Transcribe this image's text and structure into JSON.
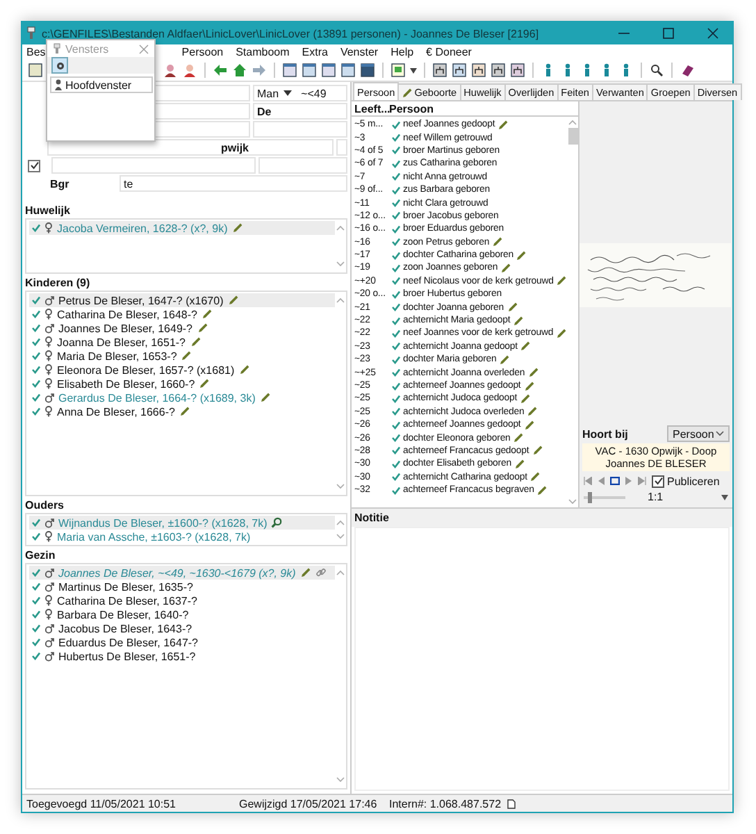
{
  "window": {
    "title": "c:\\GENFILES\\Bestanden Aldfaer\\LinicLover\\LinicLover (13891 personen) - Joannes De Bleser [2196]"
  },
  "menu": [
    "Bes",
    "Persoon",
    "Stamboom",
    "Extra",
    "Venster",
    "Help",
    "€ Doneer"
  ],
  "popup": {
    "title": "Vensters",
    "items": [
      {
        "label": "Hoofdvenster",
        "selected": true
      }
    ]
  },
  "form": {
    "sex": "Man",
    "age": "~<49",
    "surname": "De",
    "place": "pwijk",
    "flag": {
      "checked": true
    },
    "label": "Bgr",
    "value": "te"
  },
  "sections": [
    {
      "title": "Huwelijk",
      "rows": [
        {
          "text": "Jacoba Vermeiren, 1628-? (x?, 9k)",
          "kind": "female",
          "linked": true,
          "current": false,
          "selected": true,
          "edited": true,
          "found": false,
          "chained": false
        }
      ]
    },
    {
      "title": "Kinderen (9)",
      "rows": [
        {
          "text": "Petrus De Bleser, 1647-? (x1670)",
          "kind": "male",
          "linked": false,
          "current": false,
          "selected": true,
          "edited": true,
          "found": false,
          "chained": false
        },
        {
          "text": "Catharina De Bleser, 1648-?",
          "kind": "female",
          "linked": false,
          "current": false,
          "selected": false,
          "edited": true,
          "found": false,
          "chained": false
        },
        {
          "text": "Joannes De Bleser, 1649-?",
          "kind": "male",
          "linked": false,
          "current": false,
          "selected": false,
          "edited": true,
          "found": false,
          "chained": false
        },
        {
          "text": "Joanna De Bleser, 1651-?",
          "kind": "female",
          "linked": false,
          "current": false,
          "selected": false,
          "edited": true,
          "found": false,
          "chained": false
        },
        {
          "text": "Maria De Bleser, 1653-?",
          "kind": "female",
          "linked": false,
          "current": false,
          "selected": false,
          "edited": true,
          "found": false,
          "chained": false
        },
        {
          "text": "Eleonora De Bleser, 1657-? (x1681)",
          "kind": "female",
          "linked": false,
          "current": false,
          "selected": false,
          "edited": true,
          "found": false,
          "chained": false
        },
        {
          "text": "Elisabeth De Bleser, 1660-?",
          "kind": "female",
          "linked": false,
          "current": false,
          "selected": false,
          "edited": true,
          "found": false,
          "chained": false
        },
        {
          "text": "Gerardus De Bleser, 1664-? (x1689, 3k)",
          "kind": "male",
          "linked": true,
          "current": false,
          "selected": false,
          "edited": true,
          "found": false,
          "chained": false
        },
        {
          "text": "Anna De Bleser, 1666-?",
          "kind": "female",
          "linked": false,
          "current": false,
          "selected": false,
          "edited": true,
          "found": false,
          "chained": false
        }
      ]
    },
    {
      "title": "Ouders",
      "rows": [
        {
          "text": "Wijnandus De Bleser, ±1600-? (x1628, 7k)",
          "kind": "male",
          "linked": true,
          "current": false,
          "selected": true,
          "edited": false,
          "found": true,
          "chained": false
        },
        {
          "text": "Maria van Assche, ±1603-? (x1628, 7k)",
          "kind": "female",
          "linked": true,
          "current": false,
          "selected": false,
          "edited": false,
          "found": false,
          "chained": false
        }
      ]
    },
    {
      "title": "Gezin",
      "rows": [
        {
          "text": "Joannes De Bleser, ~<49, ~1630-<1679 (x?, 9k)",
          "kind": "male",
          "linked": true,
          "current": true,
          "selected": true,
          "edited": true,
          "found": false,
          "chained": true
        },
        {
          "text": "Martinus De Bleser, 1635-?",
          "kind": "male",
          "linked": false,
          "current": false,
          "selected": false,
          "edited": false,
          "found": false,
          "chained": false
        },
        {
          "text": "Catharina De Bleser, 1637-?",
          "kind": "female",
          "linked": false,
          "current": false,
          "selected": false,
          "edited": false,
          "found": false,
          "chained": false
        },
        {
          "text": "Barbara De Bleser, 1640-?",
          "kind": "female",
          "linked": false,
          "current": false,
          "selected": false,
          "edited": false,
          "found": false,
          "chained": false
        },
        {
          "text": "Jacobus De Bleser, 1643-?",
          "kind": "male",
          "linked": false,
          "current": false,
          "selected": false,
          "edited": false,
          "found": false,
          "chained": false
        },
        {
          "text": "Eduardus De Bleser, 1647-?",
          "kind": "male",
          "linked": false,
          "current": false,
          "selected": false,
          "edited": false,
          "found": false,
          "chained": false
        },
        {
          "text": "Hubertus De Bleser, 1651-?",
          "kind": "male",
          "linked": false,
          "current": false,
          "selected": false,
          "edited": false,
          "found": false,
          "chained": false
        }
      ]
    }
  ],
  "tabs": [
    {
      "label": "Persoon",
      "selected": true,
      "edited": false
    },
    {
      "label": "Geboorte",
      "selected": false,
      "edited": true
    },
    {
      "label": "Huwelijk",
      "selected": false,
      "edited": false
    },
    {
      "label": "Overlijden",
      "selected": false,
      "edited": false
    },
    {
      "label": "Feiten",
      "selected": false,
      "edited": false
    },
    {
      "label": "Verwanten",
      "selected": false,
      "edited": false
    },
    {
      "label": "Groepen",
      "selected": false,
      "edited": false
    },
    {
      "label": "Diversen",
      "selected": false,
      "edited": false
    }
  ],
  "events": {
    "columns": [
      "Leeft...",
      "Persoon"
    ],
    "rows": [
      {
        "age": "~5 m...",
        "text": "neef Joannes gedoopt",
        "edited": true
      },
      {
        "age": "~3",
        "text": "neef Willem getrouwd",
        "edited": false
      },
      {
        "age": "~4 of 5",
        "text": "broer Martinus geboren",
        "edited": false
      },
      {
        "age": "~6 of 7",
        "text": "zus Catharina geboren",
        "edited": false
      },
      {
        "age": "~7",
        "text": "nicht Anna getrouwd",
        "edited": false
      },
      {
        "age": "~9 of...",
        "text": "zus Barbara geboren",
        "edited": false
      },
      {
        "age": "~11",
        "text": "nicht Clara getrouwd",
        "edited": false
      },
      {
        "age": "~12 o...",
        "text": "broer Jacobus geboren",
        "edited": false
      },
      {
        "age": "~16 o...",
        "text": "broer Eduardus geboren",
        "edited": false
      },
      {
        "age": "~16",
        "text": "zoon Petrus geboren",
        "edited": true
      },
      {
        "age": "~17",
        "text": "dochter Catharina geboren",
        "edited": true
      },
      {
        "age": "~19",
        "text": "zoon Joannes geboren",
        "edited": true
      },
      {
        "age": "~+20",
        "text": "neef Nicolaus voor de kerk getrouwd",
        "edited": true
      },
      {
        "age": "~20 o...",
        "text": "broer Hubertus geboren",
        "edited": false
      },
      {
        "age": "~21",
        "text": "dochter Joanna geboren",
        "edited": true
      },
      {
        "age": "~22",
        "text": "achternicht Maria gedoopt",
        "edited": true
      },
      {
        "age": "~22",
        "text": "neef Joannes voor de kerk getrouwd",
        "edited": true
      },
      {
        "age": "~23",
        "text": "achternicht Joanna gedoopt",
        "edited": true
      },
      {
        "age": "~23",
        "text": "dochter Maria geboren",
        "edited": true
      },
      {
        "age": "~+25",
        "text": "achternicht Joanna overleden",
        "edited": true
      },
      {
        "age": "~25",
        "text": "achterneef Joannes gedoopt",
        "edited": true
      },
      {
        "age": "~25",
        "text": "achternicht Judoca gedoopt",
        "edited": true
      },
      {
        "age": "~25",
        "text": "achternicht Judoca overleden",
        "edited": true
      },
      {
        "age": "~26",
        "text": "achterneef Joannes gedoopt",
        "edited": true
      },
      {
        "age": "~26",
        "text": "dochter Eleonora geboren",
        "edited": true
      },
      {
        "age": "~28",
        "text": "achterneef Francacus gedoopt",
        "edited": true
      },
      {
        "age": "~30",
        "text": "dochter Elisabeth geboren",
        "edited": true
      },
      {
        "age": "~30",
        "text": "achternicht Catharina gedoopt",
        "edited": true
      },
      {
        "age": "~32",
        "text": "achterneef Francacus begraven",
        "edited": true
      }
    ]
  },
  "media": {
    "picture": {
      "kind": "picture"
    },
    "belongs_label": "Hoort bij",
    "belongs_value": "Persoon",
    "caption": [
      "VAC - 1630 Opwijk - Doop",
      "Joannes DE BLESER"
    ],
    "publish": {
      "label": "Publiceren",
      "checked": true
    },
    "zoom_slider": {
      "level": 0.1
    },
    "zoom": "1:1"
  },
  "note": {
    "title": "Notitie"
  },
  "status_bar": [
    "Toegevoegd 11/05/2021 10:51",
    "Gewijzigd 17/05/2021 17:46",
    "Intern#: 1.068.487.572"
  ]
}
